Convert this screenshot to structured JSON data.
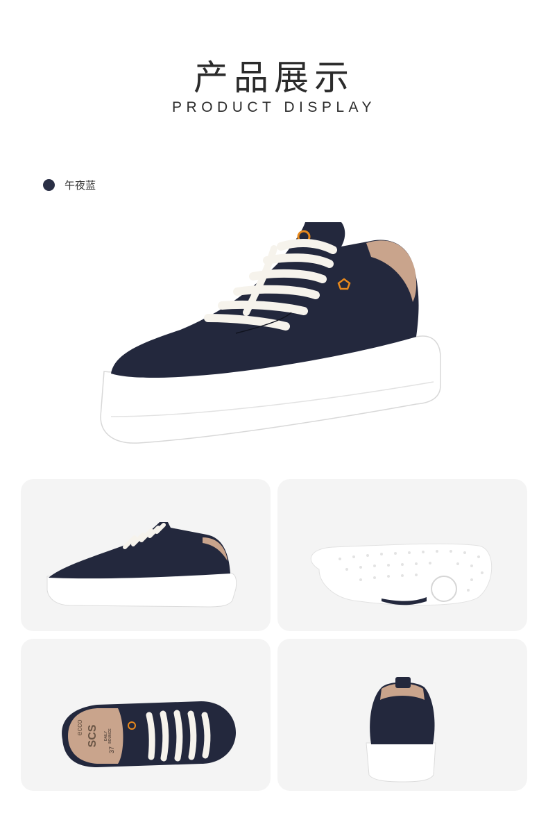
{
  "header": {
    "title_cn": "产品展示",
    "title_en": "PRODUCT DISPLAY"
  },
  "swatch": {
    "color_name": "午夜蓝",
    "color_hex": "#2a2f45"
  },
  "colors": {
    "leather": "#23283d",
    "sole": "#ffffff",
    "lining": "#c9a48c",
    "logo": "#e8891c",
    "card_bg": "#f4f4f4"
  },
  "views": [
    {
      "name": "side-view"
    },
    {
      "name": "outsole-view"
    },
    {
      "name": "top-view"
    },
    {
      "name": "back-view"
    }
  ],
  "top_view_insole": {
    "brand": "ecco",
    "model": "SCS",
    "line1": "DAILY",
    "line2": "BOUNCE",
    "size": "37"
  }
}
